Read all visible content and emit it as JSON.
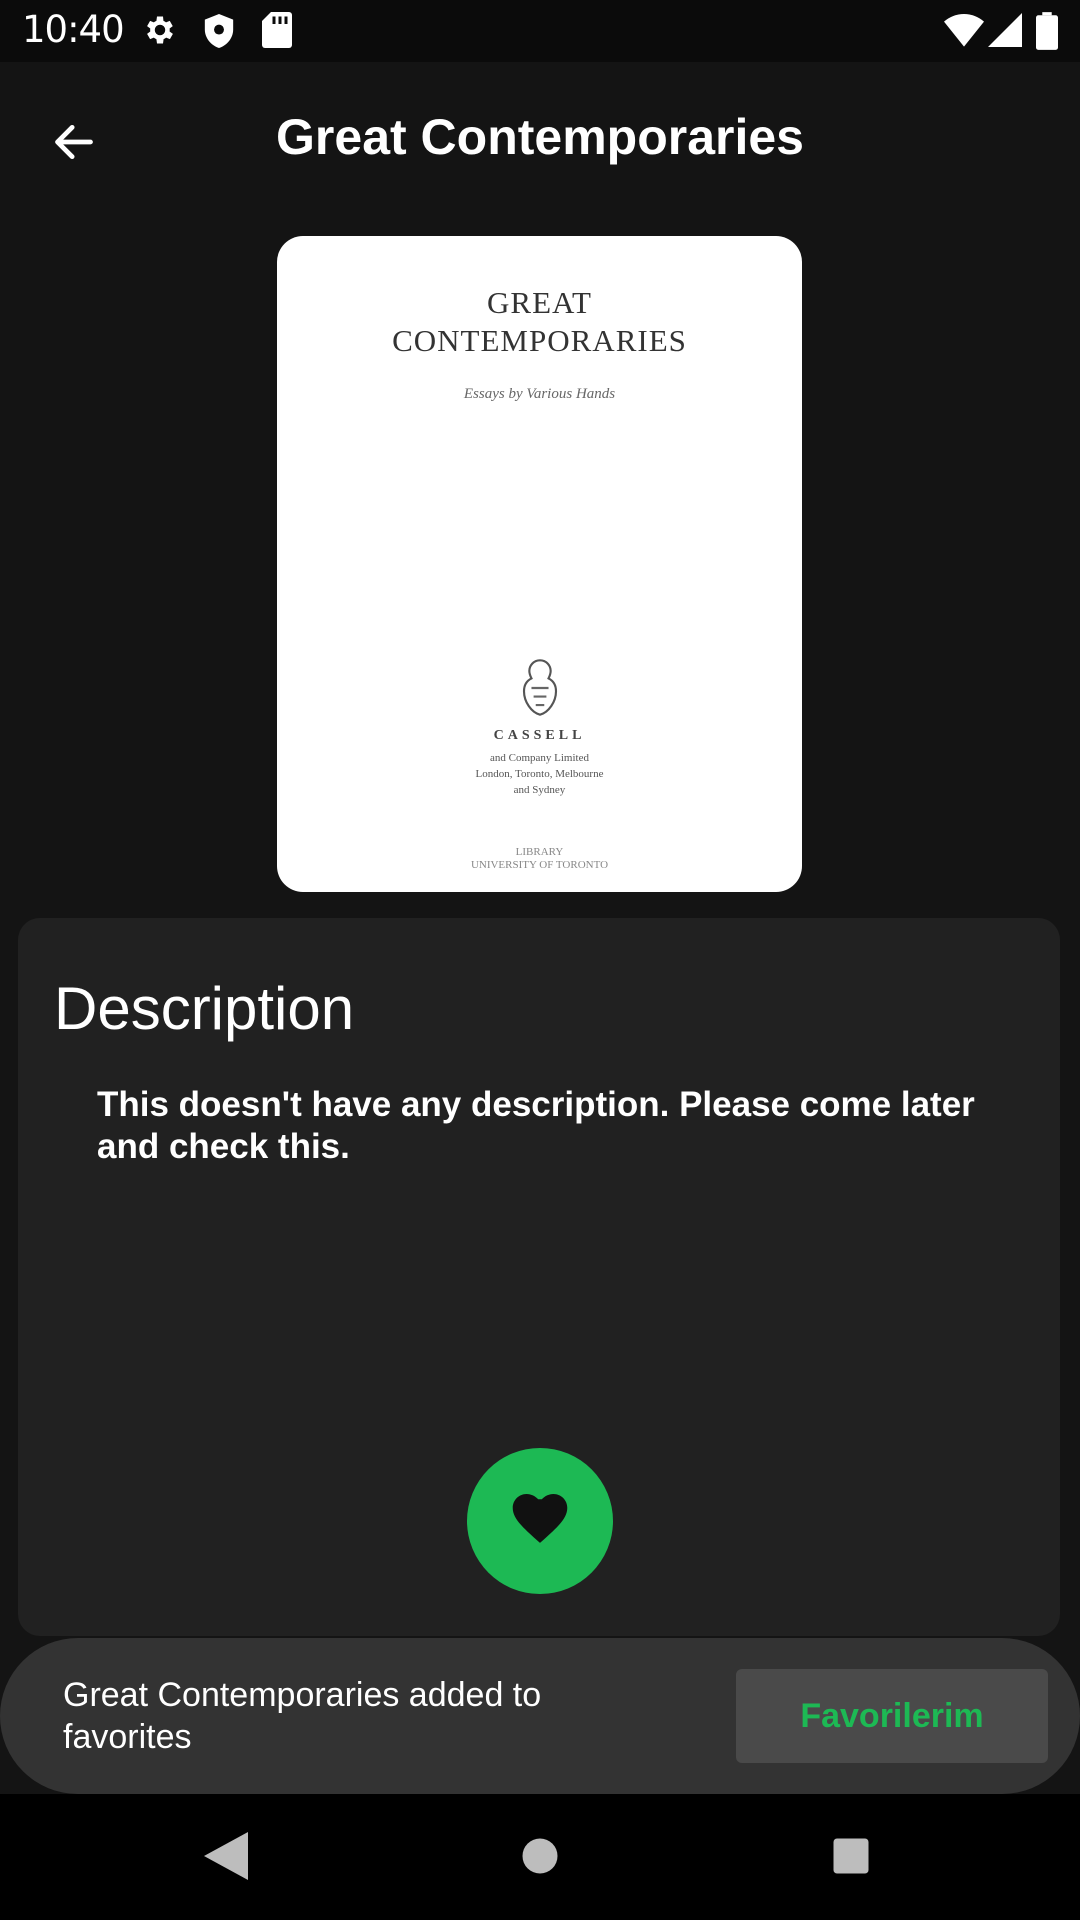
{
  "status_bar": {
    "time": "10:40",
    "left_icons": [
      "gear-icon",
      "shield-icon",
      "sd-card-icon"
    ],
    "right_icons": [
      "wifi-icon",
      "signal-icon",
      "battery-icon"
    ]
  },
  "app_bar": {
    "back_icon": "arrow-back-icon",
    "title": "Great Contemporaries"
  },
  "cover": {
    "title_line1": "GREAT",
    "title_line2": "CONTEMPORARIES",
    "subtitle": "Essays by Various Hands",
    "publisher": "CASSELL",
    "publisher_line1": "and Company Limited",
    "publisher_line2": "London, Toronto, Melbourne",
    "publisher_line3": "and Sydney",
    "stamp_line1": "LIBRARY",
    "stamp_line2": "UNIVERSITY OF TORONTO"
  },
  "description": {
    "heading": "Description",
    "text": "This doesn't have any description. Please come later and check this."
  },
  "favorite_button": {
    "icon": "heart-icon",
    "color": "#1db954"
  },
  "snackbar": {
    "message": "Great Contemporaries  added to favorites",
    "action_label": "Favorilerim",
    "action_color": "#1db954"
  },
  "nav_bar": {
    "icons": [
      "back-triangle-icon",
      "home-circle-icon",
      "recents-square-icon"
    ]
  }
}
